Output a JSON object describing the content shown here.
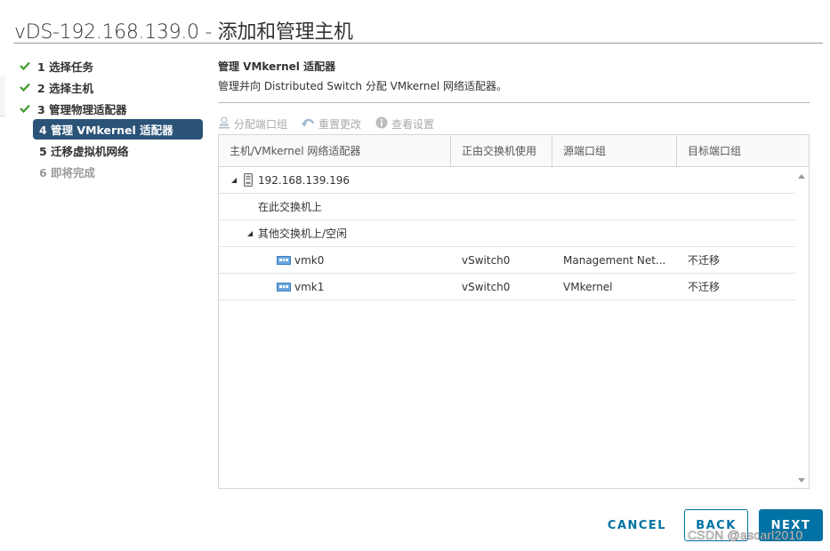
{
  "dialog": {
    "title": "vDS-192.168.139.0 - 添加和管理主机"
  },
  "steps": [
    {
      "label": "1 选择任务",
      "state": "done"
    },
    {
      "label": "2 选择主机",
      "state": "done"
    },
    {
      "label": "3 管理物理适配器",
      "state": "done"
    },
    {
      "label": "4 管理 VMkernel 适配器",
      "state": "active"
    },
    {
      "label": "5 迁移虚拟机网络",
      "state": "pending"
    },
    {
      "label": "6 即将完成",
      "state": "disabled"
    }
  ],
  "content": {
    "title": "管理 VMkernel 适配器",
    "description": "管理并向 Distributed Switch 分配 VMkernel 网络适配器。"
  },
  "toolbar": {
    "assign_port_group": {
      "label": "分配端口组",
      "icon": "assign-portgroup-icon",
      "enabled": false
    },
    "reset_changes": {
      "label": "重置更改",
      "icon": "undo-icon",
      "enabled": false
    },
    "view_settings": {
      "label": "查看设置",
      "icon": "info-icon",
      "enabled": false
    }
  },
  "grid": {
    "columns": [
      "主机/VMkernel 网络适配器",
      "正由交换机使用",
      "源端口组",
      "目标端口组"
    ],
    "host": {
      "name": "192.168.139.196",
      "expanded": true
    },
    "groups": [
      {
        "label": "在此交换机上",
        "expanded": false
      },
      {
        "label": "其他交换机上/空闲",
        "expanded": true
      }
    ],
    "adapters": [
      {
        "name": "vmk0",
        "switch": "vSwitch0",
        "source_port_group": "Management Net...",
        "target_port_group": "不迁移"
      },
      {
        "name": "vmk1",
        "switch": "vSwitch0",
        "source_port_group": "VMkernel",
        "target_port_group": "不迁移"
      }
    ]
  },
  "footer": {
    "cancel_label": "CANCEL",
    "back_label": "BACK",
    "next_label": "NEXT"
  },
  "watermark": "CSDN @ascarl2010",
  "colors": {
    "active_step": "#2b5378",
    "primary": "#0072a3",
    "check": "#3c9b2b"
  }
}
